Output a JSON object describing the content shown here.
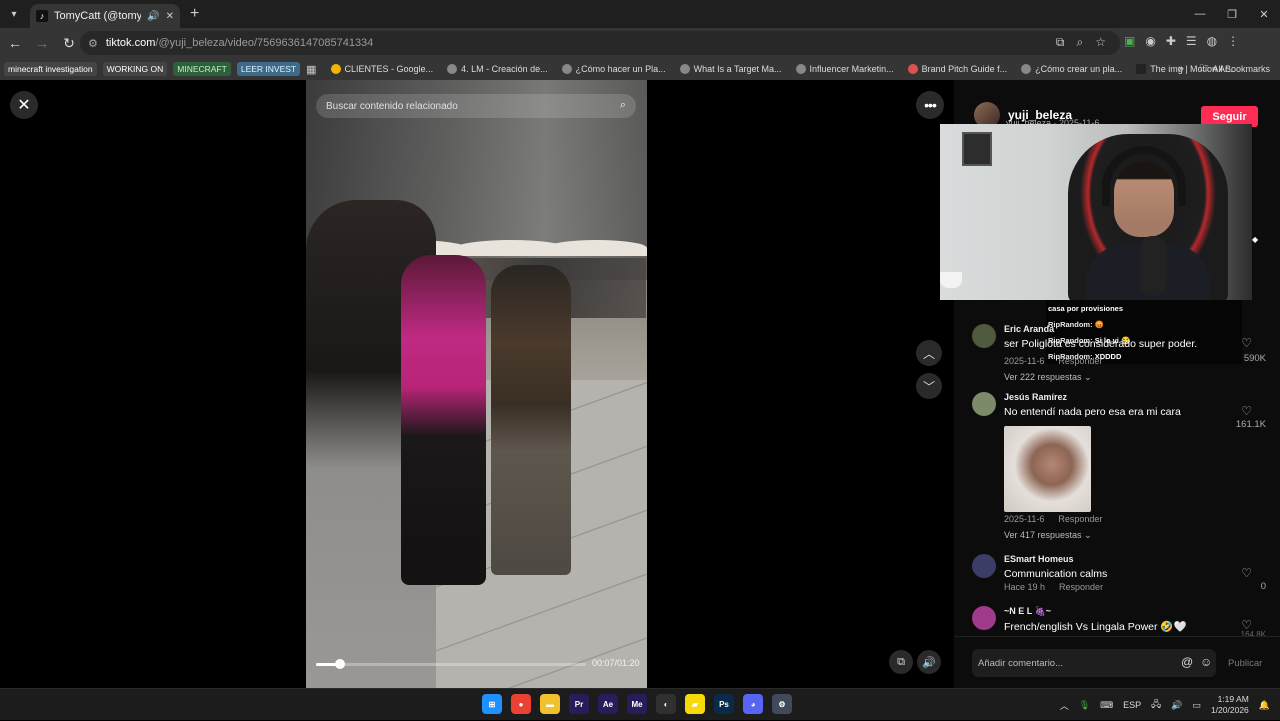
{
  "browser": {
    "tab_title": "TomyCatt (@tomycatts) | Ti",
    "url_host": "tiktok.com",
    "url_path": "/@yuji_beleza/video/7569636147085741334",
    "bookmarks_chips": [
      {
        "label": "minecraft investigation",
        "color": "#4a4a4a"
      },
      {
        "label": "WORKING ON",
        "color": "#4a4a4a"
      },
      {
        "label": "MINECRAFT",
        "color": "#2f5f3b"
      },
      {
        "label": "LEER INVEST",
        "color": "#3f6b8a"
      }
    ],
    "bookmarks": [
      "CLIENTES - Google...",
      "4. LM - Creación de...",
      "¿Cómo hacer un Pla...",
      "What Is a Target Ma...",
      "Influencer Marketin...",
      "Brand Pitch Guide f...",
      "¿Cómo crear un pla...",
      "The img | Motion Ar..."
    ],
    "all_bookmarks": "All Bookmarks"
  },
  "video": {
    "search_placeholder": "Buscar contenido relacionado",
    "time": "00:07/01:20",
    "progress_fraction": 0.0875
  },
  "author": {
    "name": "yuji_beleza",
    "sub": "yuji_beleza · 2025-11-6",
    "follow_label": "Seguir"
  },
  "chat": [
    {
      "text": "casa por provisiones"
    },
    {
      "user": "RipRandom:",
      "text": "😡"
    },
    {
      "user": "RipRandom:",
      "text": "Si lo vi 😂"
    },
    {
      "user": "RipRandom:",
      "text": "XDDDD"
    }
  ],
  "comments": [
    {
      "name": "Eric Aranda",
      "text": "ser Poliglota es considerado super poder.",
      "date": "2025-11-6",
      "reply": "Responder",
      "replies": "Ver 222 respuestas",
      "likes": "590K",
      "avatar_color": "#4f5a3e"
    },
    {
      "name": "Jesús Ramírez",
      "text": "No entendí nada pero esa era mi cara",
      "date": "2025-11-6",
      "reply": "Responder",
      "replies": "Ver 417 respuestas",
      "likes": "161.1K",
      "avatar_color": "#7d8a6a"
    },
    {
      "name": "ESmart Homeus",
      "text": "Communication calms",
      "date": "Hace 19 h",
      "reply": "Responder",
      "likes": "0",
      "avatar_color": "#3b3d66"
    },
    {
      "name": "~N E L 🍇~",
      "text": "French/english Vs Lingala Power 🤣🤍",
      "likes": "164.8K",
      "avatar_color": "#a03a8a"
    }
  ],
  "comment_box": {
    "placeholder": "Añadir comentario...",
    "post_label": "Publicar"
  },
  "taskbar": {
    "lang": "ESP",
    "time": "1:19 AM",
    "date": "1/20/2026",
    "apps": [
      {
        "name": "windows",
        "label": "⊞",
        "color": "#1e90ff"
      },
      {
        "name": "chrome",
        "label": "●",
        "color": "#e94235"
      },
      {
        "name": "explorer",
        "label": "▬",
        "color": "#f2c12e"
      },
      {
        "name": "premiere",
        "label": "Pr",
        "color": "#2a1c5a"
      },
      {
        "name": "after-effects",
        "label": "Ae",
        "color": "#2a1c5a"
      },
      {
        "name": "media-encoder",
        "label": "Me",
        "color": "#2a1c5a"
      },
      {
        "name": "obs",
        "label": "◐",
        "color": "#303030"
      },
      {
        "name": "sticky-notes",
        "label": "▰",
        "color": "#f5d90a"
      },
      {
        "name": "photoshop",
        "label": "Ps",
        "color": "#0a2a4a"
      },
      {
        "name": "discord",
        "label": "◕",
        "color": "#5865f2"
      },
      {
        "name": "settings",
        "label": "⚙",
        "color": "#404a58"
      }
    ]
  }
}
